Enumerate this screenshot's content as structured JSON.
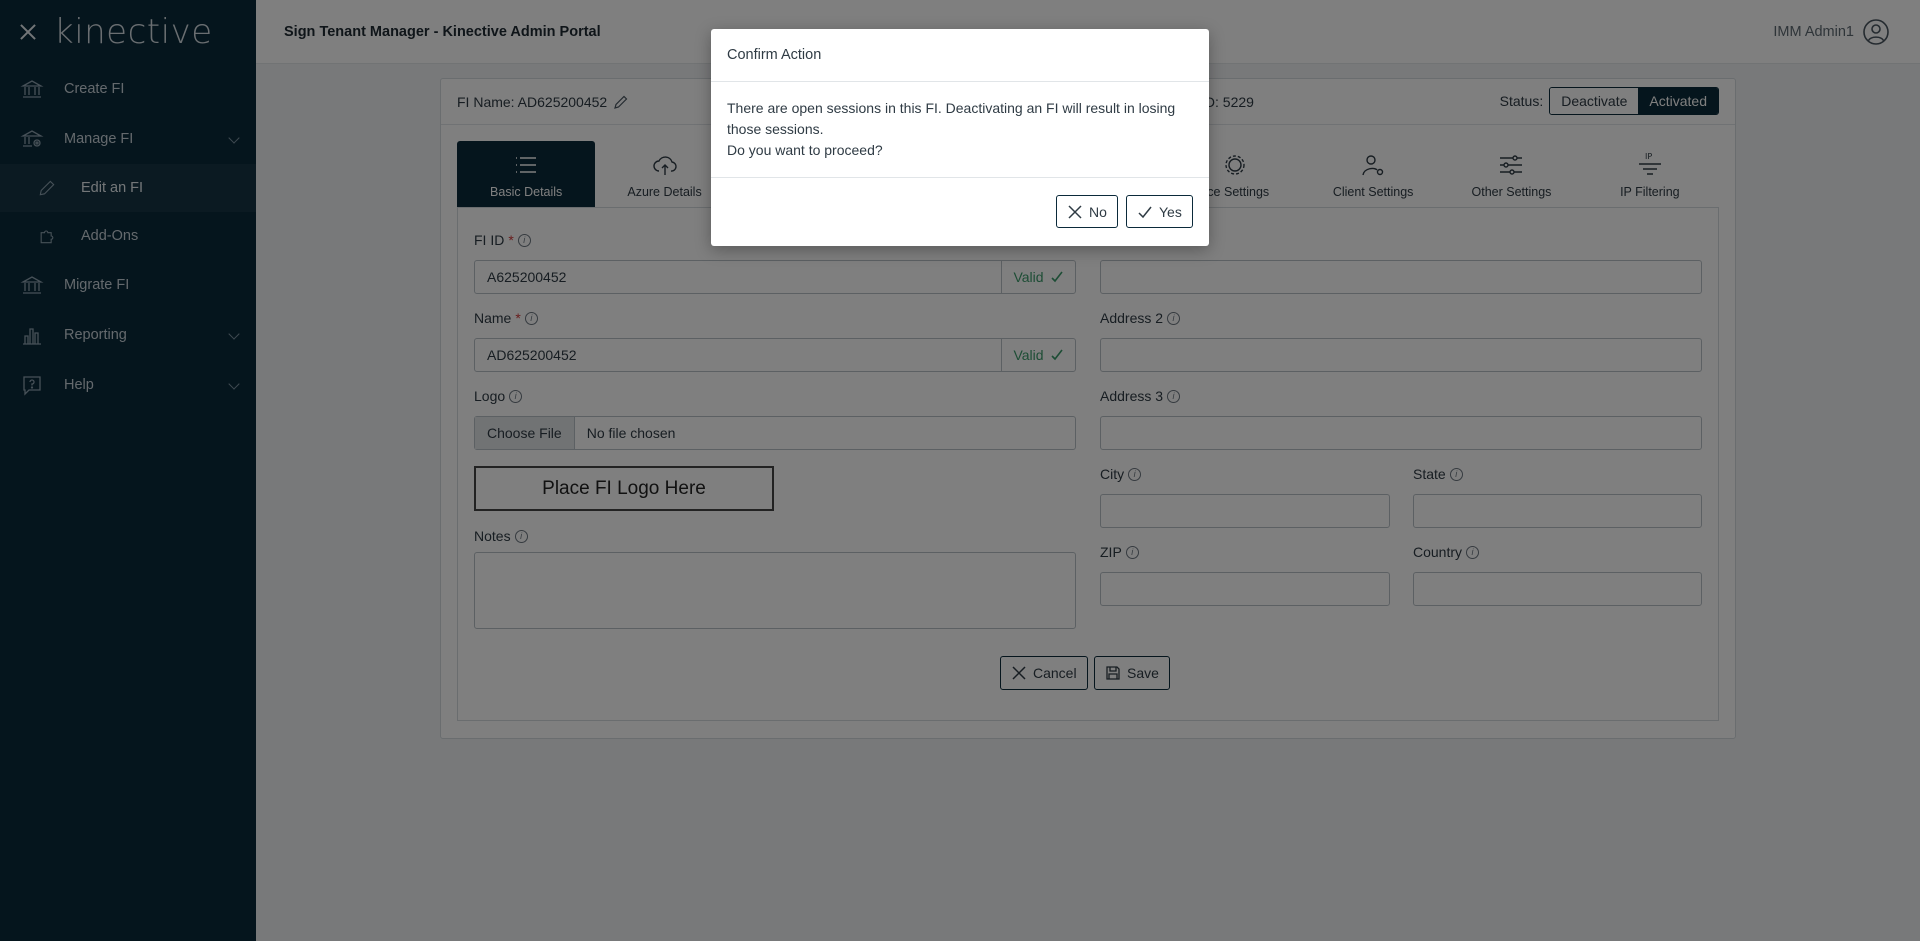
{
  "sidebar": {
    "logo": "kinective",
    "items": [
      {
        "label": "Create FI"
      },
      {
        "label": "Manage FI"
      },
      {
        "label": "Edit an FI"
      },
      {
        "label": "Add-Ons"
      },
      {
        "label": "Migrate FI"
      },
      {
        "label": "Reporting"
      },
      {
        "label": "Help"
      }
    ]
  },
  "header": {
    "title": "Sign Tenant Manager - Kinective Admin Portal",
    "user": "IMM Admin1"
  },
  "card": {
    "fi_name": "FI Name: AD625200452",
    "fi_id_text": "ID: 5229",
    "status_label": "Status:",
    "deactivate": "Deactivate",
    "activated": "Activated"
  },
  "tabs": [
    {
      "label": "Basic Details"
    },
    {
      "label": "Azure Details"
    },
    {
      "label": "nce Settings"
    },
    {
      "label": "Client Settings"
    },
    {
      "label": "Other Settings"
    },
    {
      "label": "IP Filtering"
    }
  ],
  "form": {
    "fi_id_label": "FI ID",
    "required_mark": "*",
    "fi_id_value": "A625200452",
    "valid_text": "Valid",
    "name_label": "Name",
    "name_value": "AD625200452",
    "logo_label": "Logo",
    "choose_file": "Choose File",
    "no_file": "No file chosen",
    "logo_placeholder": "Place FI Logo Here",
    "notes_label": "Notes",
    "address2_label": "Address 2",
    "address3_label": "Address 3",
    "city_label": "City",
    "state_label": "State",
    "zip_label": "ZIP",
    "country_label": "Country",
    "cancel": "Cancel",
    "save": "Save",
    "info_glyph": "i"
  },
  "modal": {
    "title": "Confirm Action",
    "line1": "There are open sessions in this FI. Deactivating an FI will result in losing those sessions.",
    "line2": "Do you want to proceed?",
    "no": "No",
    "yes": "Yes"
  },
  "colors": {
    "sidebar_bg": "#0b2a3a",
    "accent": "#0b2a3a",
    "valid": "#3a9a6a",
    "required": "#d23a3a"
  }
}
